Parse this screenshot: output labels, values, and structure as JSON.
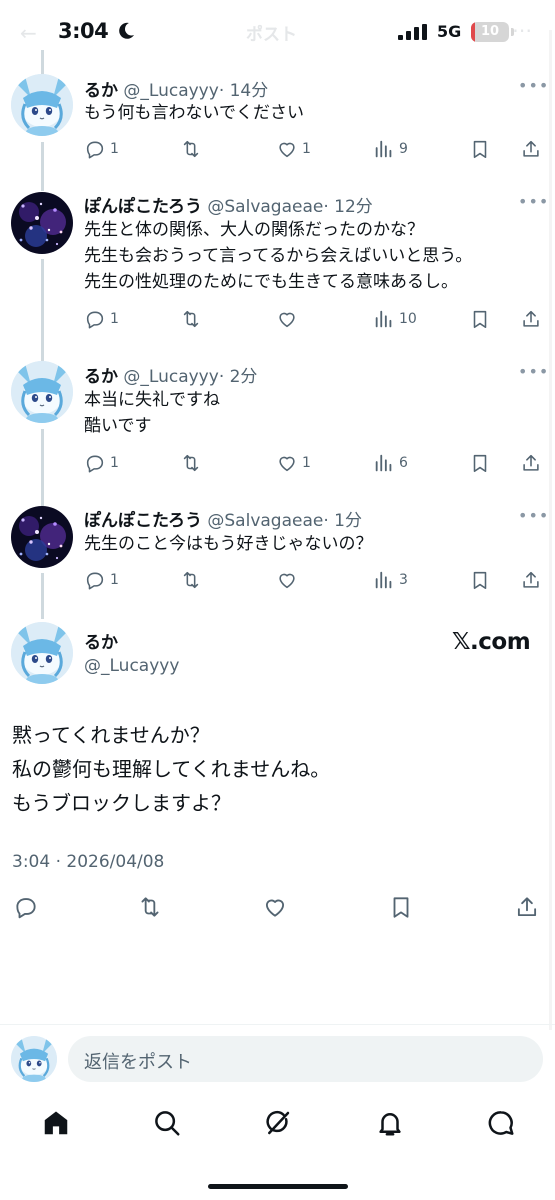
{
  "status_bar": {
    "time": "3:04",
    "network": "5G",
    "battery": "10",
    "battery_level_percent": 10,
    "icons": [
      "moon-icon",
      "signal-icon"
    ]
  },
  "header": {
    "title": "ポスト"
  },
  "replies": [
    {
      "name": "るか",
      "handle": "@_Lucayyy",
      "time": "· 14分",
      "lines": [
        "もう何も言わないでください"
      ],
      "replies": "1",
      "likes": "1",
      "views": "9",
      "avatar": "glaceon-avatar"
    },
    {
      "name": "ぽんぽこたろう",
      "handle": "@Salvagaeae",
      "time": "· 12分",
      "lines": [
        "先生と体の関係、大人の関係だったのかな？",
        "先生も会おうって言ってるから会えばいいと思う。",
        "先生の性処理のためにでも生きてる意味あるし。"
      ],
      "replies": "1",
      "likes": "",
      "views": "10",
      "avatar": "purple-night-avatar"
    },
    {
      "name": "るか",
      "handle": "@_Lucayyy",
      "time": "· 2分",
      "lines": [
        "本当に失礼ですね",
        "酷いです"
      ],
      "replies": "1",
      "likes": "1",
      "views": "6",
      "avatar": "glaceon-avatar"
    },
    {
      "name": "ぽんぽこたろう",
      "handle": "@Salvagaeae",
      "time": "· 1分",
      "lines": [
        "先生のこと今はもう好きじゃないの？"
      ],
      "replies": "1",
      "likes": "",
      "views": "3",
      "avatar": "purple-night-avatar"
    }
  ],
  "main_post": {
    "name": "るか",
    "handle": "@_Lucayyy",
    "lines": [
      "黙ってくれませんか？",
      "私の鬱何も理解してくれませんね。",
      "もうブロックしますよ？"
    ],
    "meta": "3:04 · 2026/04/08"
  },
  "watermark": "𝕏.com",
  "composer": {
    "placeholder": "返信をポスト"
  },
  "tabs": [
    "home",
    "search",
    "grok",
    "notifications",
    "messages"
  ],
  "colors": {
    "text": "#0f1419",
    "secondary": "#536471",
    "thread_line": "#cfd9de",
    "composer_bg": "#eff3f4",
    "battery_red": "#e0494c"
  }
}
